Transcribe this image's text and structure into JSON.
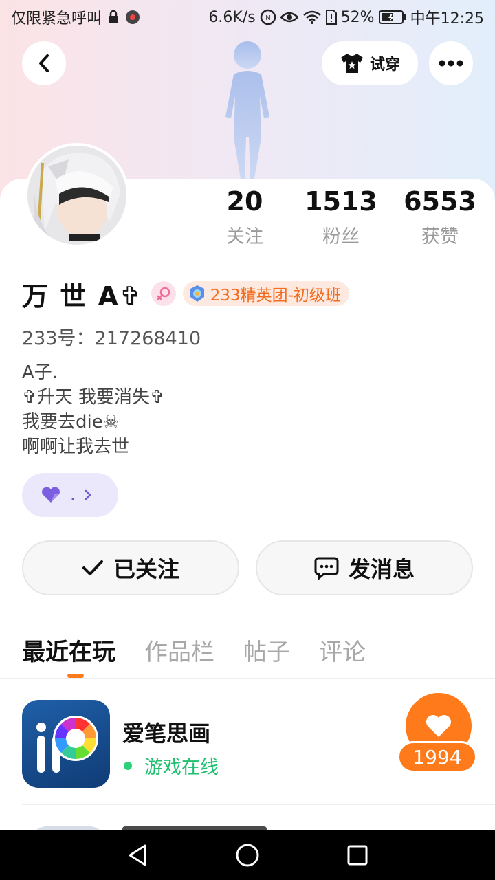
{
  "status_bar": {
    "carrier": "仅限紧急呼叫",
    "net_speed": "6.6K/s",
    "battery": "52%",
    "time": "中午12:25"
  },
  "header": {
    "try_on_label": "试穿"
  },
  "stats": [
    {
      "value": "20",
      "label": "关注"
    },
    {
      "value": "1513",
      "label": "粉丝"
    },
    {
      "value": "6553",
      "label": "获赞"
    }
  ],
  "profile": {
    "name": "万 世 A✞",
    "group": "233精英团-初级班",
    "uid": "233号：217268410",
    "bio": [
      "A子.",
      "✞升天 我要消失✞",
      "我要去die☠",
      "啊啊让我去世"
    ],
    "tag_text": "."
  },
  "actions": {
    "follow_label": "已关注",
    "message_label": "发消息"
  },
  "tabs": [
    "最近在玩",
    "作品栏",
    "帖子",
    "评论"
  ],
  "game": {
    "name": "爱笔思画",
    "status": "游戏在线",
    "likes": "1994"
  },
  "colors": {
    "accent": "#ff7a1a",
    "online": "#1fbf6f",
    "group_badge_text": "#f26d1f"
  }
}
